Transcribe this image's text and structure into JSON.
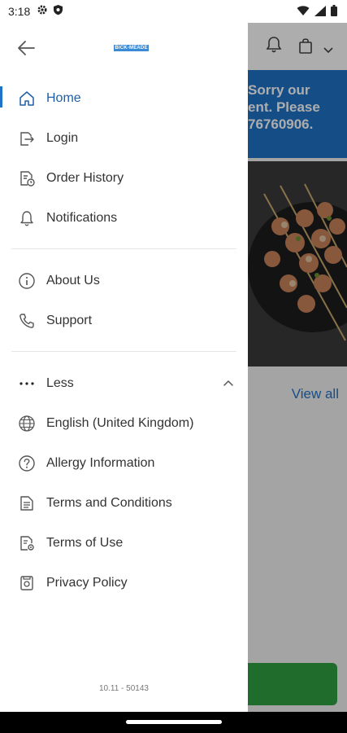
{
  "status_bar": {
    "time": "3:18",
    "icons": [
      "gear-icon",
      "shield-icon",
      "wifi-icon",
      "signal-icon",
      "battery-icon"
    ]
  },
  "drawer": {
    "back_icon": "arrow-left-icon",
    "brand_logo_text": "BICK-MEADE",
    "primary_items": [
      {
        "label": "Home",
        "icon": "home-icon",
        "active": true
      },
      {
        "label": "Login",
        "icon": "login-icon",
        "active": false
      },
      {
        "label": "Order History",
        "icon": "order-history-icon",
        "active": false
      },
      {
        "label": "Notifications",
        "icon": "bell-icon",
        "active": false
      }
    ],
    "secondary_items": [
      {
        "label": "About Us",
        "icon": "info-icon"
      },
      {
        "label": "Support",
        "icon": "phone-icon"
      }
    ],
    "less": {
      "label": "Less",
      "icon": "more-dots-icon",
      "chevron": "chevron-up-icon"
    },
    "extra_items": [
      {
        "label": "English (United Kingdom)",
        "icon": "globe-icon"
      },
      {
        "label": "Allergy Information",
        "icon": "question-icon"
      },
      {
        "label": "Terms and Conditions",
        "icon": "document-icon"
      },
      {
        "label": "Terms of Use",
        "icon": "document-settings-icon"
      },
      {
        "label": "Privacy Policy",
        "icon": "privacy-icon"
      }
    ],
    "version": "10.11 - 50143"
  },
  "background_app": {
    "banner_lines": [
      "Sorry our",
      "ent. Please",
      "76760906."
    ],
    "view_all": "View all"
  },
  "colors": {
    "accent": "#1f73c7",
    "active_text": "#1f5fa8",
    "cart_button": "#2ea043"
  }
}
